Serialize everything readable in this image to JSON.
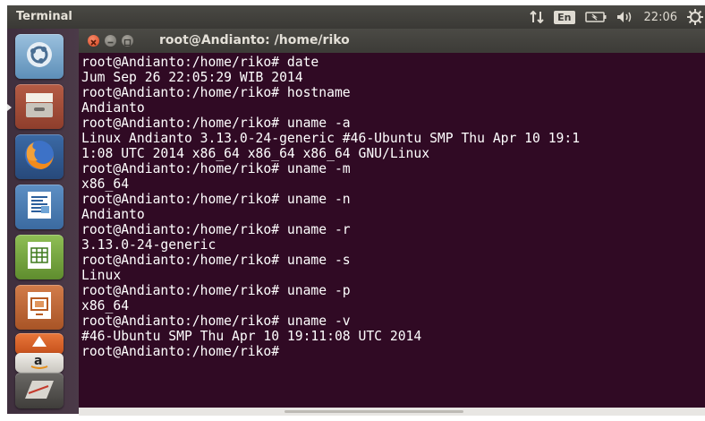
{
  "panel": {
    "app_title": "Terminal",
    "keyboard_layout": "En",
    "clock": "22:06"
  },
  "window": {
    "title": "root@Andianto: /home/riko"
  },
  "terminal": {
    "background": "#300a24",
    "lines": [
      "root@Andianto:/home/riko# date",
      "Jum Sep 26 22:05:29 WIB 2014",
      "root@Andianto:/home/riko# hostname",
      "Andianto",
      "root@Andianto:/home/riko# uname -a",
      "Linux Andianto 3.13.0-24-generic #46-Ubuntu SMP Thu Apr 10 19:1",
      "1:08 UTC 2014 x86_64 x86_64 x86_64 GNU/Linux",
      "root@Andianto:/home/riko# uname -m",
      "x86_64",
      "root@Andianto:/home/riko# uname -n",
      "Andianto",
      "root@Andianto:/home/riko# uname -r",
      "3.13.0-24-generic",
      "root@Andianto:/home/riko# uname -s",
      "Linux",
      "root@Andianto:/home/riko# uname -p",
      "x86_64",
      "root@Andianto:/home/riko# uname -v",
      "#46-Ubuntu SMP Thu Apr 10 19:11:08 UTC 2014",
      "root@Andianto:/home/riko#"
    ]
  },
  "launcher": {
    "icons": [
      "ubuntu-dash-icon",
      "files-icon",
      "firefox-icon",
      "writer-icon",
      "calc-icon",
      "impress-icon",
      "software-center-icon",
      "amazon-icon",
      "workspace-switcher-icon"
    ]
  }
}
